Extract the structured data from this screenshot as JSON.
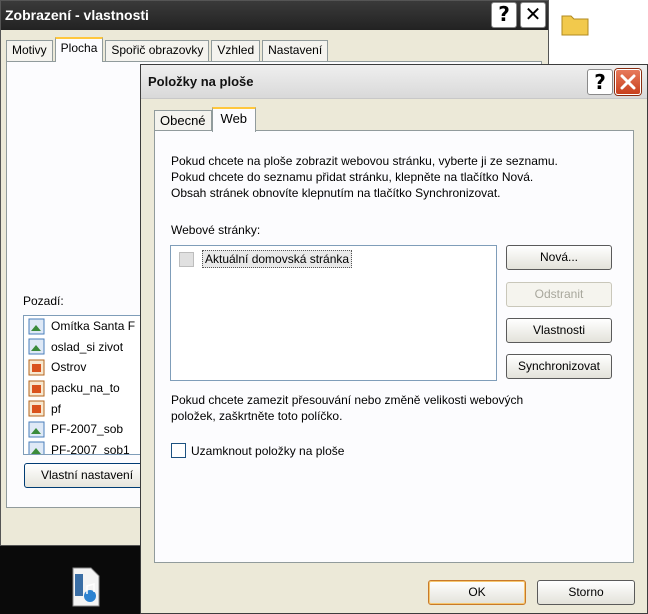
{
  "back_window": {
    "title": "Zobrazení - vlastnosti",
    "tabs": [
      "Motivy",
      "Plocha",
      "Spořič obrazovky",
      "Vzhled",
      "Nastavení"
    ],
    "active_tab": "Plocha",
    "pozadi_label": "Pozadí:",
    "backgrounds": [
      "Omítka Santa F",
      "oslad_si zivot",
      "Ostrov",
      "packu_na_to",
      "pf",
      "PF-2007_sob",
      "PF-2007_sob1"
    ],
    "custom_button_label": "Vlastní nastavení"
  },
  "dialog": {
    "title": "Položky na ploše",
    "tabs": [
      "Obecné",
      "Web"
    ],
    "active_tab": "Web",
    "intro_lines": [
      "Pokud chcete na ploše zobrazit webovou stránku, vyberte ji ze seznamu.",
      "Pokud chcete do seznamu přidat stránku, klepněte na tlačítko Nová.",
      "Obsah stránek obnovíte klepnutím na tlačítko Synchronizovat."
    ],
    "web_pages_label": "Webové stránky:",
    "web_pages": [
      {
        "label": "Aktuální domovská stránka",
        "checked": false
      }
    ],
    "buttons": {
      "new": "Nová...",
      "remove": "Odstranit",
      "properties": "Vlastnosti",
      "sync": "Synchronizovat"
    },
    "lock_text_lines": [
      "Pokud chcete zamezit přesouvání nebo změně velikosti webových",
      "položek, zaškrtněte toto políčko."
    ],
    "lock_checkbox_label": "Uzamknout položky na ploše",
    "lock_checked": false,
    "ok": "OK",
    "cancel": "Storno"
  },
  "icons": {
    "help": "?",
    "close": "✕"
  },
  "colors": {
    "close_button": "#d1532f",
    "active_tab_accent": "#ffc73c"
  }
}
